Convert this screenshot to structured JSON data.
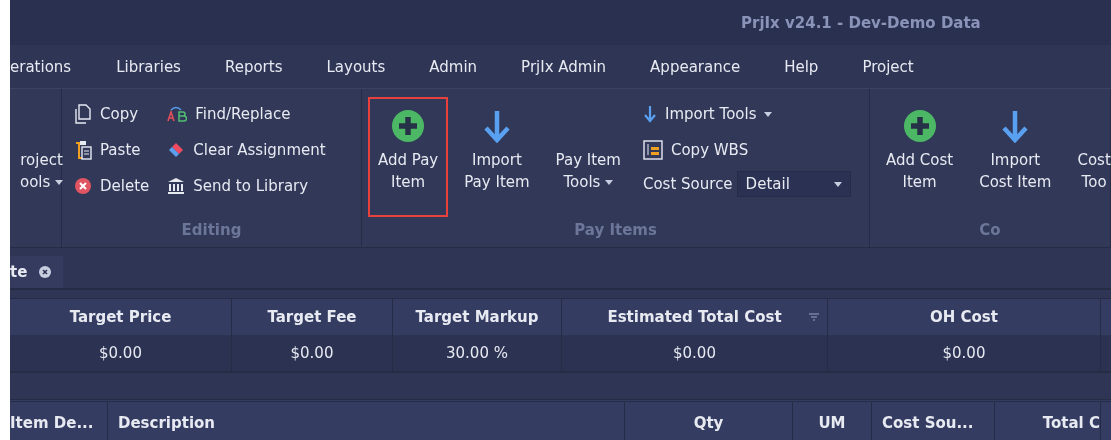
{
  "window": {
    "title": "PrjIx v24.1 - Dev-Demo Data"
  },
  "menu": [
    {
      "label": "erations"
    },
    {
      "label": "Libraries"
    },
    {
      "label": "Reports"
    },
    {
      "label": "Layouts"
    },
    {
      "label": "Admin"
    },
    {
      "label": "PrjIx Admin"
    },
    {
      "label": "Appearance"
    },
    {
      "label": "Help"
    },
    {
      "label": "Project"
    }
  ],
  "ribbon": {
    "groups": [
      {
        "items": [
          {
            "kind": "menu-large",
            "lines": [
              "roject",
              "ools"
            ],
            "dropdown": true,
            "highlighted": false
          }
        ]
      },
      {
        "label": "Editing",
        "items": [
          {
            "kind": "stack",
            "buttons": [
              {
                "kind": "copy",
                "label": "Copy"
              },
              {
                "kind": "paste",
                "label": "Paste"
              },
              {
                "kind": "delete",
                "label": "Delete"
              }
            ]
          },
          {
            "kind": "stack",
            "buttons": [
              {
                "kind": "find",
                "label": "Find/Replace"
              },
              {
                "kind": "eraser",
                "label": "Clear Assignment"
              },
              {
                "kind": "library",
                "label": "Send to Library"
              }
            ]
          }
        ]
      },
      {
        "label": "Pay Items",
        "items": [
          {
            "kind": "add-large",
            "lines": [
              "Add Pay",
              "Item"
            ],
            "dropdown": false,
            "highlighted": true
          },
          {
            "kind": "import-large",
            "lines": [
              "Import",
              "Pay Item"
            ],
            "dropdown": false,
            "highlighted": false
          },
          {
            "kind": "menu-large",
            "lines": [
              "Pay Item",
              "Tools"
            ],
            "dropdown": true,
            "highlighted": false
          },
          {
            "kind": "stack",
            "buttons": [
              {
                "kind": "import-menu",
                "label": "Import Tools"
              },
              {
                "kind": "wbs",
                "label": "Copy WBS"
              },
              {
                "kind": "combo",
                "label": "Cost Source",
                "value": "Detail"
              }
            ]
          }
        ]
      },
      {
        "label": "Co",
        "items": [
          {
            "kind": "add-large",
            "lines": [
              "Add Cost",
              "Item"
            ],
            "dropdown": false,
            "highlighted": false
          },
          {
            "kind": "import-large",
            "lines": [
              "Import",
              "Cost Item"
            ],
            "dropdown": false,
            "highlighted": false
          },
          {
            "kind": "menu-large",
            "lines": [
              "Cost",
              "Too"
            ],
            "dropdown": false,
            "highlighted": false
          }
        ]
      }
    ]
  },
  "tabs": [
    {
      "label": "te"
    }
  ],
  "summary": {
    "columns": [
      {
        "label": "Target Price",
        "sort_icon": false
      },
      {
        "label": "Target Fee",
        "sort_icon": false
      },
      {
        "label": "Target Markup",
        "sort_icon": false
      },
      {
        "label": "Estimated Total Cost",
        "sort_icon": true
      },
      {
        "label": "OH Cost",
        "sort_icon": false
      }
    ],
    "values": [
      "$0.00",
      "$0.00",
      "30.00 %",
      "$0.00",
      "$0.00"
    ]
  },
  "grid": {
    "columns": [
      "Item De...",
      "Description",
      "Qty",
      "UM",
      "Cost Sou...",
      "Total C"
    ]
  }
}
